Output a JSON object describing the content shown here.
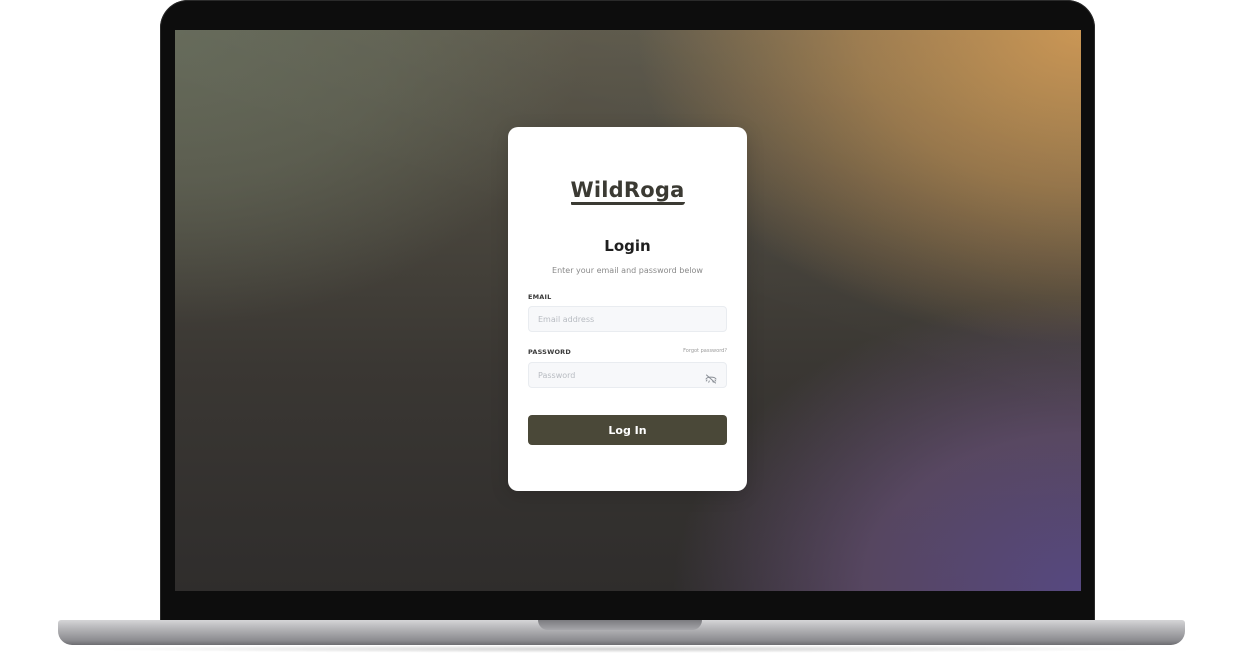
{
  "brand": {
    "logo_text": "WildRoga",
    "primary_color": "#4a4838"
  },
  "login": {
    "title": "Login",
    "subtitle": "Enter your email and password below",
    "email_label": "EMAIL",
    "email_placeholder": "Email address",
    "email_value": "",
    "password_label": "PASSWORD",
    "password_placeholder": "Password",
    "password_value": "",
    "forgot_password_link": "Forgot password?",
    "password_toggle_icon": "eye-off-icon",
    "submit_label": "Log In"
  }
}
